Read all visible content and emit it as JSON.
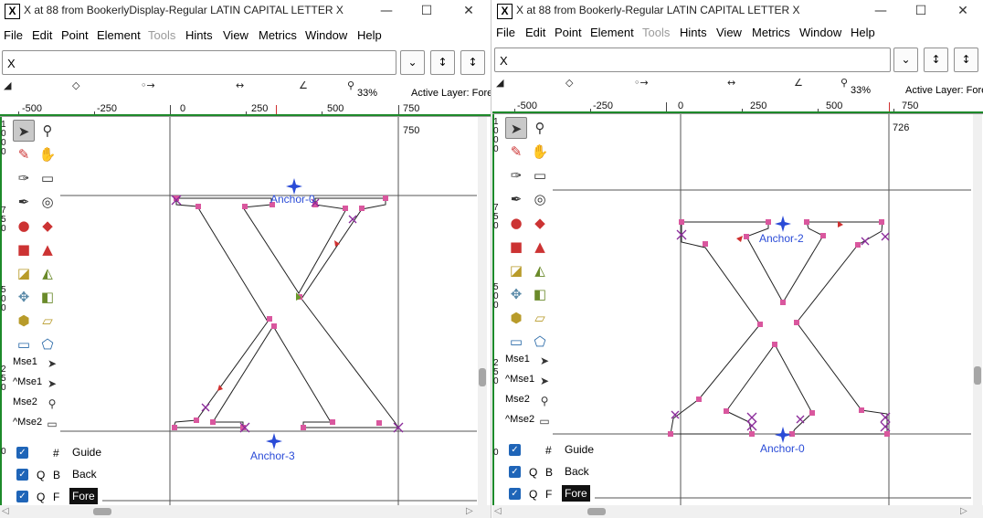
{
  "left_window": {
    "title": "X at 88 from BookerlyDisplay-Regular LATIN CAPITAL LETTER X",
    "name_field": "X",
    "zoom": "33%",
    "active_layer": "Active Layer: Fore",
    "ruler_labels": [
      "-500",
      "-250",
      "0",
      "250",
      "500",
      "750"
    ],
    "advance_label": "750",
    "anchors": [
      "Anchor-0",
      "Anchor-3"
    ]
  },
  "right_window": {
    "title": "X at 88 from Bookerly-Regular LATIN CAPITAL LETTER X",
    "name_field": "X",
    "zoom": "33%",
    "active_layer": "Active Layer: Fore",
    "ruler_labels": [
      "-500",
      "-250",
      "0",
      "250",
      "500",
      "750"
    ],
    "advance_label": "726",
    "anchors": [
      "Anchor-2",
      "Anchor-0"
    ]
  },
  "menu": [
    "File",
    "Edit",
    "Point",
    "Element",
    "Tools",
    "Hints",
    "View",
    "Metrics",
    "Window",
    "Help"
  ],
  "window_controls": {
    "minimize": "—",
    "maximize": "☐",
    "close": "✕"
  },
  "field_buttons": [
    "⌄",
    "↕",
    "↕"
  ],
  "mouse_labels": [
    "Mse1",
    "^Mse1",
    "Mse2",
    "^Mse2"
  ],
  "layers": [
    {
      "q": "",
      "b": "#",
      "name": "Guide",
      "checked": true
    },
    {
      "q": "Q",
      "b": "B",
      "name": "Back",
      "checked": true
    },
    {
      "q": "Q",
      "b": "F",
      "name": "Fore",
      "checked": true,
      "current": true
    }
  ],
  "colors": {
    "outline": "#222222",
    "point": "#d9579e",
    "anchor": "#2a4bd7",
    "guide": "#555555",
    "ruler_green": "#1d8a2a",
    "ruler_red": "#d03030"
  }
}
